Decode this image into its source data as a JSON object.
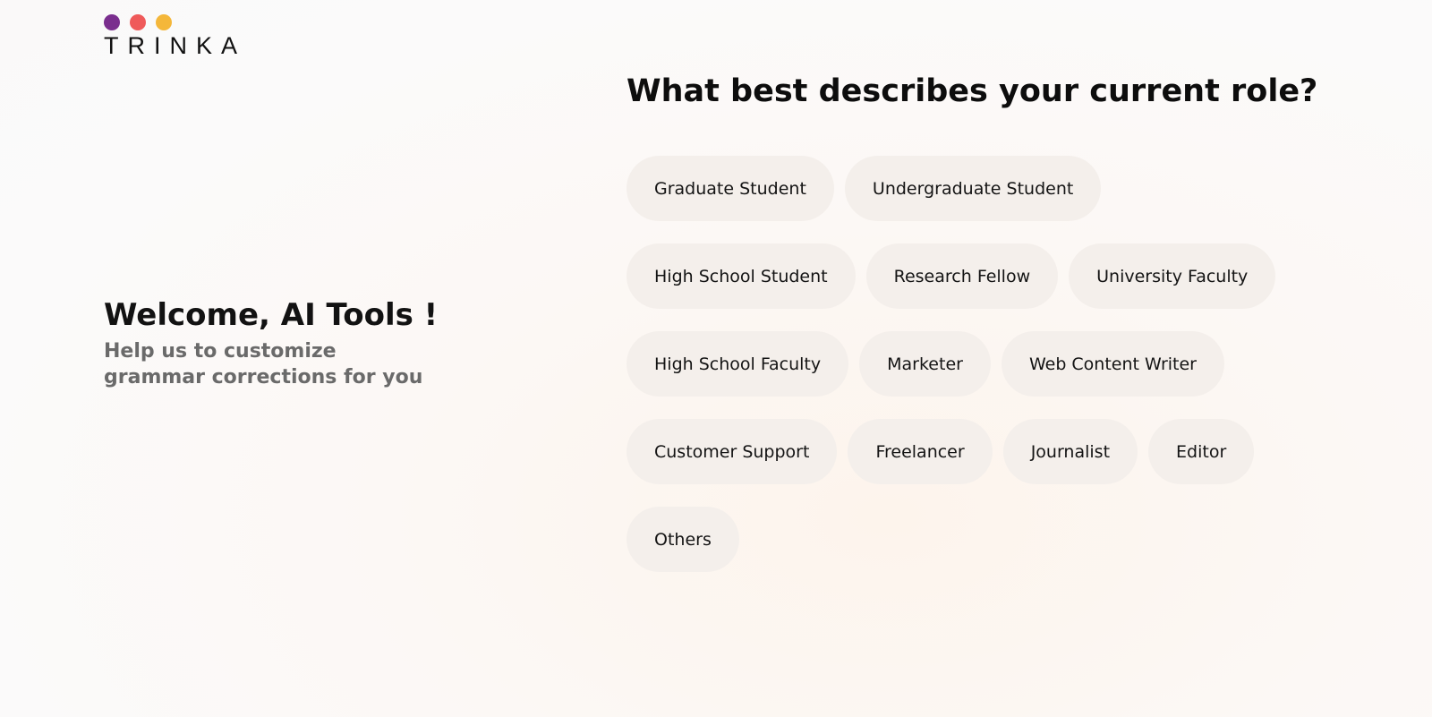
{
  "logo": {
    "text": "TRINKA",
    "dot_colors": [
      "#7a2e8e",
      "#ef5a5a",
      "#f4b73a"
    ]
  },
  "welcome": {
    "title": "Welcome, AI Tools !",
    "subtitle": "Help us to customize grammar corrections for you"
  },
  "question": "What best describes your current role?",
  "roles": {
    "row1": [
      "Graduate Student",
      "Undergraduate Student"
    ],
    "row2": [
      "High School Student",
      "Research Fellow",
      "University Faculty"
    ],
    "row3": [
      "High School Faculty",
      "Marketer",
      "Web Content Writer"
    ],
    "row4": [
      "Customer Support",
      "Freelancer",
      "Journalist",
      "Editor"
    ],
    "row5": [
      "Others"
    ]
  },
  "colors": {
    "chip_background": "#f4efeb",
    "title_text": "#121212",
    "subtitle_text": "#6a6a6a"
  }
}
